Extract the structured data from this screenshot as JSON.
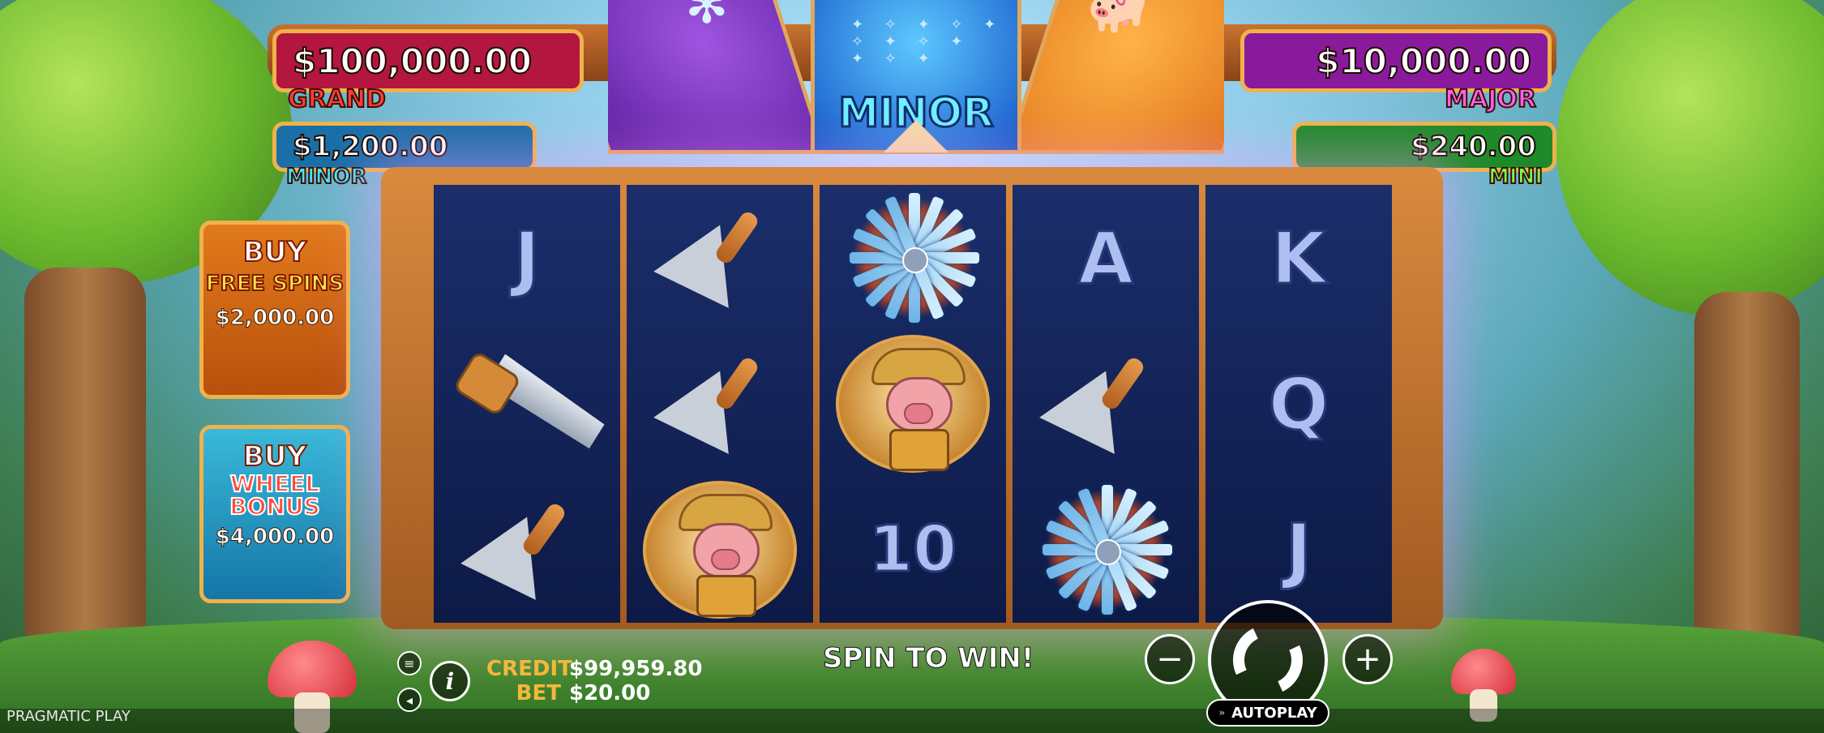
{
  "jackpots": {
    "grand": {
      "value": "$100,000.00",
      "name": "GRAND"
    },
    "major": {
      "value": "$10,000.00",
      "name": "MAJOR"
    },
    "minor": {
      "value": "$1,200.00",
      "name": "MINOR"
    },
    "mini": {
      "value": "$240.00",
      "name": "MINI"
    }
  },
  "wheel": {
    "center_label": "MINOR",
    "left_icon": "windmill-icon",
    "right_icon": "piggy-bank-icon"
  },
  "reels": [
    [
      "J",
      "saw",
      "trowel"
    ],
    [
      "trowel",
      "trowel",
      "pig"
    ],
    [
      "windmill",
      "pig",
      "10"
    ],
    [
      "A",
      "trowel",
      "windmill"
    ],
    [
      "K",
      "Q",
      "J"
    ]
  ],
  "buy_free_spins": {
    "line1": "BUY",
    "line2": "FREE SPINS",
    "price": "$2,000.00"
  },
  "buy_wheel_bonus": {
    "line1": "BUY",
    "line2": "WHEEL",
    "line3": "BONUS",
    "price": "$4,000.00"
  },
  "footer": {
    "provider": "PRAGMATIC PLAY",
    "credit_label": "CREDIT",
    "credit_value": "$99,959.80",
    "bet_label": "BET",
    "bet_value": "$20.00",
    "message": "SPIN TO WIN!",
    "minus": "−",
    "plus": "+",
    "autoplay": "AUTOPLAY",
    "info": "i"
  },
  "colors": {
    "grand": "#b3163f",
    "major": "#8a1a9c",
    "minor": "#1a6fa8",
    "mini": "#1f8a2a",
    "frame": "#c47332"
  }
}
